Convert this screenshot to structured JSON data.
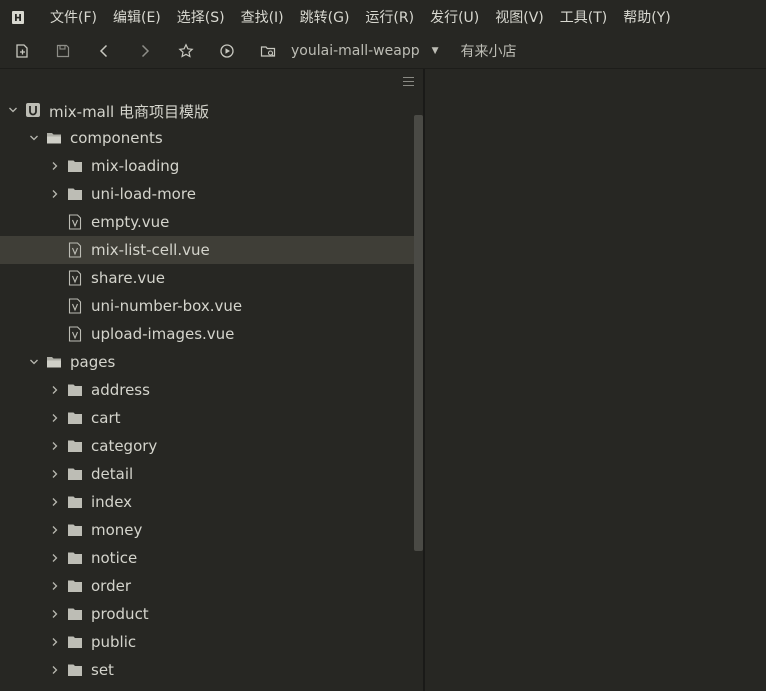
{
  "menu": {
    "items": [
      "文件(F)",
      "编辑(E)",
      "选择(S)",
      "查找(I)",
      "跳转(G)",
      "运行(R)",
      "发行(U)",
      "视图(V)",
      "工具(T)",
      "帮助(Y)"
    ]
  },
  "toolbar": {
    "icons": [
      "new-file-icon",
      "save-icon",
      "back-icon",
      "forward-icon",
      "star-icon",
      "run-icon",
      "browse-folder-icon"
    ],
    "project": "youlai-mall-weapp",
    "store": "有来小店"
  },
  "tree": {
    "root": "mix-mall 电商项目模版",
    "components": {
      "label": "components",
      "folders": [
        "mix-loading",
        "uni-load-more"
      ],
      "files": [
        "empty.vue",
        "mix-list-cell.vue",
        "share.vue",
        "uni-number-box.vue",
        "upload-images.vue"
      ],
      "selected": "mix-list-cell.vue"
    },
    "pages": {
      "label": "pages",
      "folders": [
        "address",
        "cart",
        "category",
        "detail",
        "index",
        "money",
        "notice",
        "order",
        "product",
        "public",
        "set"
      ]
    }
  },
  "colors": {
    "background": "#272723",
    "selected_row": "#3f3e37",
    "text": "#d4d4cc"
  }
}
